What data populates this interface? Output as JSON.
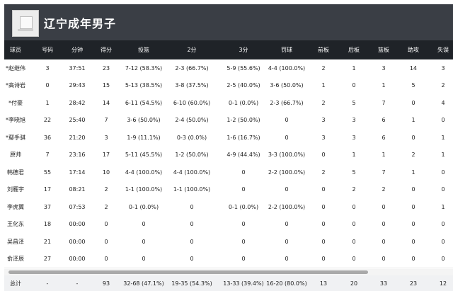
{
  "team": {
    "name": "辽宁成年男子"
  },
  "columns": [
    "球员",
    "号码",
    "分钟",
    "得分",
    "投篮",
    "2分",
    "3分",
    "罚球",
    "前板",
    "后板",
    "篮板",
    "助攻",
    "失误"
  ],
  "rows": [
    [
      "*赵继伟",
      "3",
      "37:51",
      "23",
      "7-12 (58.3%)",
      "2-3 (66.7%)",
      "5-9 (55.6%)",
      "4-4 (100.0%)",
      "2",
      "1",
      "3",
      "14",
      "3"
    ],
    [
      "*高诗岩",
      "0",
      "29:43",
      "15",
      "5-13 (38.5%)",
      "3-8 (37.5%)",
      "2-5 (40.0%)",
      "3-6 (50.0%)",
      "1",
      "0",
      "1",
      "5",
      "2"
    ],
    [
      "*付豪",
      "1",
      "28:42",
      "14",
      "6-11 (54.5%)",
      "6-10 (60.0%)",
      "0-1 (0.0%)",
      "2-3 (66.7%)",
      "2",
      "5",
      "7",
      "0",
      "4"
    ],
    [
      "*李晓旭",
      "22",
      "25:40",
      "7",
      "3-6 (50.0%)",
      "2-4 (50.0%)",
      "1-2 (50.0%)",
      "0",
      "3",
      "3",
      "6",
      "1",
      "0"
    ],
    [
      "*鄢手骐",
      "36",
      "21:20",
      "3",
      "1-9 (11.1%)",
      "0-3 (0.0%)",
      "1-6 (16.7%)",
      "0",
      "3",
      "3",
      "6",
      "0",
      "1"
    ],
    [
      "原帅",
      "7",
      "23:16",
      "17",
      "5-11 (45.5%)",
      "1-2 (50.0%)",
      "4-9 (44.4%)",
      "3-3 (100.0%)",
      "0",
      "1",
      "1",
      "2",
      "1"
    ],
    [
      "韩德君",
      "55",
      "17:14",
      "10",
      "4-4 (100.0%)",
      "4-4 (100.0%)",
      "0",
      "2-2 (100.0%)",
      "2",
      "5",
      "7",
      "1",
      "0"
    ],
    [
      "刘雁宇",
      "17",
      "08:21",
      "2",
      "1-1 (100.0%)",
      "1-1 (100.0%)",
      "0",
      "0",
      "0",
      "2",
      "2",
      "0",
      "0"
    ],
    [
      "李虎翼",
      "37",
      "07:53",
      "2",
      "0-1 (0.0%)",
      "0",
      "0-1 (0.0%)",
      "2-2 (100.0%)",
      "0",
      "0",
      "0",
      "0",
      "1"
    ],
    [
      "王化东",
      "18",
      "00:00",
      "0",
      "0",
      "0",
      "0",
      "0",
      "0",
      "0",
      "0",
      "0",
      "0"
    ],
    [
      "吴昌泽",
      "21",
      "00:00",
      "0",
      "0",
      "0",
      "0",
      "0",
      "0",
      "0",
      "0",
      "0",
      "0"
    ],
    [
      "俞泽辰",
      "27",
      "00:00",
      "0",
      "0",
      "0",
      "0",
      "0",
      "0",
      "0",
      "0",
      "0",
      "0"
    ]
  ],
  "total": [
    "总计",
    "-",
    "-",
    "93",
    "32-68 (47.1%)",
    "19-35 (54.3%)",
    "13-33 (39.4%)",
    "16-20 (80.0%)",
    "13",
    "20",
    "33",
    "23",
    "12"
  ]
}
